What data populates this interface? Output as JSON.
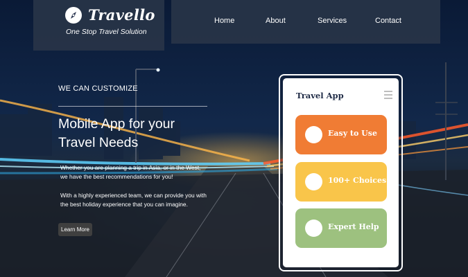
{
  "brand": {
    "name": "Travello",
    "tagline": "One Stop Travel Solution"
  },
  "nav": {
    "items": [
      "Home",
      "About",
      "Services",
      "Contact"
    ]
  },
  "hero": {
    "eyebrow": "WE CAN CUSTOMIZE",
    "title_line1": "Mobile App for your",
    "title_line2": "Travel Needs",
    "para1": "Whether you are planning a trip in Asia, or in the West, we have the best recommendations for you!",
    "para2": "With a highly experienced team, we can provide you with the best holiday experience that you can imagine.",
    "button": "Learn More"
  },
  "app": {
    "title": "Travel App",
    "cards": [
      {
        "label": "Easy to Use",
        "color": "#f07c34"
      },
      {
        "label": "100+ Choices",
        "color": "#f9c54a"
      },
      {
        "label": "Expert Help",
        "color": "#9dc17f"
      }
    ]
  },
  "icons": {
    "logo": "compass-icon",
    "menu": "hamburger-menu-icon"
  }
}
